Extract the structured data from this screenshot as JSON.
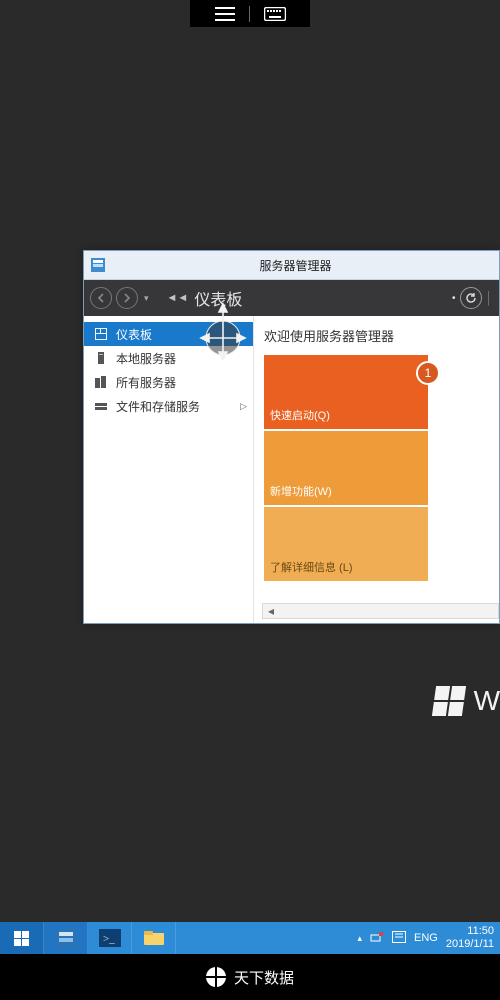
{
  "window": {
    "title": "服务器管理器",
    "breadcrumb_label": "仪表板"
  },
  "sidebar": {
    "items": [
      {
        "label": "仪表板",
        "icon": "dashboard-icon",
        "selected": true
      },
      {
        "label": "本地服务器",
        "icon": "server-icon",
        "selected": false
      },
      {
        "label": "所有服务器",
        "icon": "servers-icon",
        "selected": false
      },
      {
        "label": "文件和存储服务",
        "icon": "storage-icon",
        "selected": false,
        "expandable": true
      }
    ]
  },
  "content": {
    "heading": "欢迎使用服务器管理器",
    "tiles": [
      {
        "label": "快速启动(Q)",
        "badge": "1"
      },
      {
        "label": "新增功能(W)"
      },
      {
        "label": "了解详细信息 (L)"
      }
    ]
  },
  "watermark": {
    "text": "W"
  },
  "taskbar": {
    "tray": {
      "ime": "ENG",
      "time": "11:50",
      "date": "2019/1/11"
    }
  },
  "brand": {
    "name": "天下数据"
  }
}
